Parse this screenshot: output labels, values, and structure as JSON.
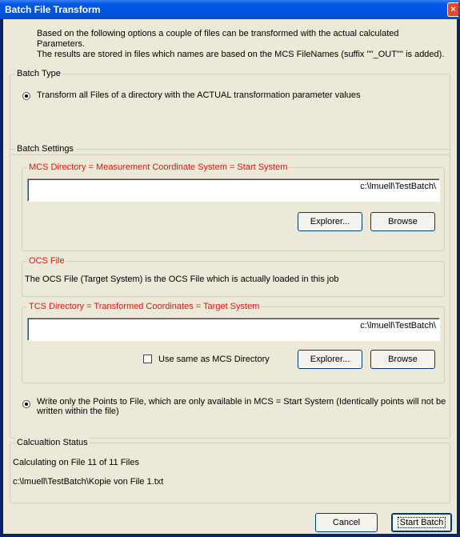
{
  "window": {
    "title": "Batch File Transform",
    "close_glyph": "×"
  },
  "intro": {
    "line1": "Based on the following options a couple of files can be transformed with the actual calculated Parameters.",
    "line2": "The results are stored in files which names are based on the MCS FileNames (suffix '\"'_OUT\"'' is added)."
  },
  "batch_type": {
    "legend": "Batch Type",
    "option_label": "Transform all Files of a directory with the ACTUAL transformation parameter values"
  },
  "batch_settings": {
    "legend": "Batch Settings",
    "mcs": {
      "legend": "MCS Directory = Measurement Coordinate System = Start System",
      "value": "c:\\lmuell\\TestBatch\\",
      "explorer_label": "Explorer...",
      "browse_label": "Browse"
    },
    "ocs": {
      "legend": "OCS File",
      "text": "The OCS File (Target System) is the OCS File which is actually loaded in this job"
    },
    "tcs": {
      "legend": "TCS Directory = Transformed Coordinates = Target System",
      "value": "c:\\lmuell\\TestBatch\\",
      "same_as_mcs_label": "Use same as MCS Directory",
      "explorer_label": "Explorer...",
      "browse_label": "Browse"
    },
    "write_option": {
      "line1": "Write only the Points to File, which are only available in MCS = Start System (Identically points will not be",
      "line2": "written within the file)"
    }
  },
  "status": {
    "legend": "Calcualtion Status",
    "line1": "Calculating on File 11 of 11 Files",
    "line2": "c:\\lmuell\\TestBatch\\Kopie von File 1.txt"
  },
  "footer": {
    "cancel_label": "Cancel",
    "start_label": "Start Batch"
  }
}
